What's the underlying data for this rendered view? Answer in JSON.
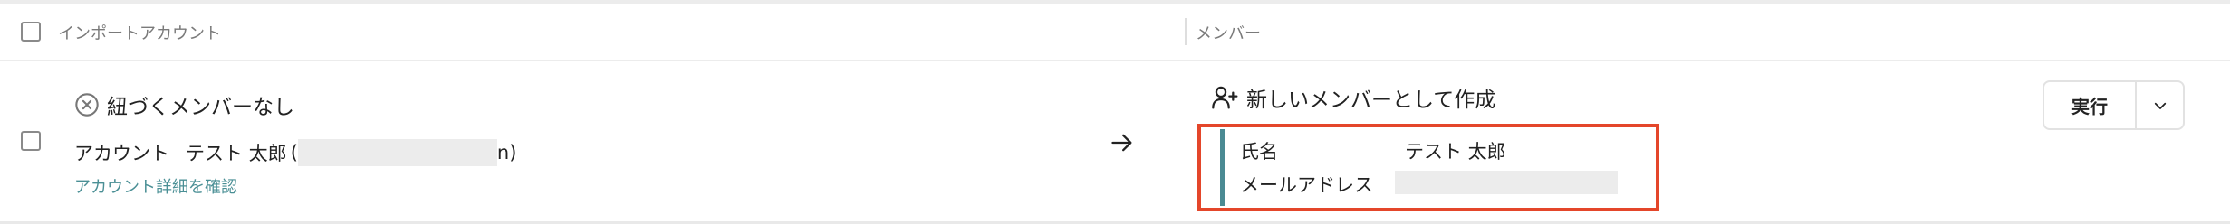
{
  "header": {
    "import_account_label": "インポートアカウント",
    "member_label": "メンバー"
  },
  "row": {
    "status_icon": "x-circle-icon",
    "status_text": "紐づくメンバーなし",
    "account_prefix": "アカウント",
    "account_name": "テスト 太郎",
    "account_paren_open": "(",
    "account_paren_close": "n)",
    "detail_link": "アカウント詳細を確認",
    "arrow_icon": "arrow-right-icon",
    "create_icon": "person-plus-icon",
    "create_text": "新しいメンバーとして作成",
    "fields": {
      "name_label": "氏名",
      "name_value": "テスト 太郎",
      "email_label": "メールアドレス"
    },
    "execute_button": "実行",
    "dropdown_icon": "chevron-down-icon"
  },
  "colors": {
    "highlight_border": "#e4462a",
    "accent_bar": "#4a8a93",
    "link": "#4a8f95"
  }
}
